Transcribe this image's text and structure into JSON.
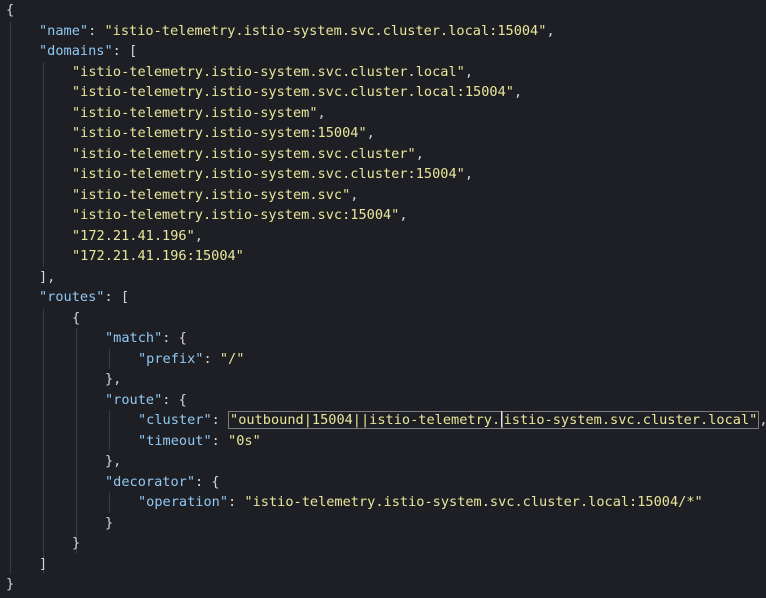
{
  "editor": {
    "lines": [
      {
        "indent": 0,
        "tokens": [
          [
            "pun",
            "{"
          ]
        ]
      },
      {
        "indent": 1,
        "tokens": [
          [
            "key",
            "\"name\""
          ],
          [
            "pun",
            ": "
          ],
          [
            "str",
            "\"istio-telemetry.istio-system.svc.cluster.local:15004\""
          ],
          [
            "pun",
            ","
          ]
        ]
      },
      {
        "indent": 1,
        "tokens": [
          [
            "key",
            "\"domains\""
          ],
          [
            "pun",
            ": ["
          ]
        ]
      },
      {
        "indent": 2,
        "tokens": [
          [
            "str",
            "\"istio-telemetry.istio-system.svc.cluster.local\""
          ],
          [
            "pun",
            ","
          ]
        ]
      },
      {
        "indent": 2,
        "tokens": [
          [
            "str",
            "\"istio-telemetry.istio-system.svc.cluster.local:15004\""
          ],
          [
            "pun",
            ","
          ]
        ]
      },
      {
        "indent": 2,
        "tokens": [
          [
            "str",
            "\"istio-telemetry.istio-system\""
          ],
          [
            "pun",
            ","
          ]
        ]
      },
      {
        "indent": 2,
        "tokens": [
          [
            "str",
            "\"istio-telemetry.istio-system:15004\""
          ],
          [
            "pun",
            ","
          ]
        ]
      },
      {
        "indent": 2,
        "tokens": [
          [
            "str",
            "\"istio-telemetry.istio-system.svc.cluster\""
          ],
          [
            "pun",
            ","
          ]
        ]
      },
      {
        "indent": 2,
        "tokens": [
          [
            "str",
            "\"istio-telemetry.istio-system.svc.cluster:15004\""
          ],
          [
            "pun",
            ","
          ]
        ]
      },
      {
        "indent": 2,
        "tokens": [
          [
            "str",
            "\"istio-telemetry.istio-system.svc\""
          ],
          [
            "pun",
            ","
          ]
        ]
      },
      {
        "indent": 2,
        "tokens": [
          [
            "str",
            "\"istio-telemetry.istio-system.svc:15004\""
          ],
          [
            "pun",
            ","
          ]
        ]
      },
      {
        "indent": 2,
        "tokens": [
          [
            "str",
            "\"172.21.41.196\""
          ],
          [
            "pun",
            ","
          ]
        ]
      },
      {
        "indent": 2,
        "tokens": [
          [
            "str",
            "\"172.21.41.196:15004\""
          ]
        ]
      },
      {
        "indent": 1,
        "tokens": [
          [
            "pun",
            "],"
          ]
        ]
      },
      {
        "indent": 1,
        "tokens": [
          [
            "key",
            "\"routes\""
          ],
          [
            "pun",
            ": ["
          ]
        ]
      },
      {
        "indent": 2,
        "tokens": [
          [
            "pun",
            "{"
          ]
        ]
      },
      {
        "indent": 3,
        "tokens": [
          [
            "key",
            "\"match\""
          ],
          [
            "pun",
            ": {"
          ]
        ]
      },
      {
        "indent": 4,
        "tokens": [
          [
            "key",
            "\"prefix\""
          ],
          [
            "pun",
            ": "
          ],
          [
            "str",
            "\"/\""
          ]
        ]
      },
      {
        "indent": 3,
        "tokens": [
          [
            "pun",
            "},"
          ]
        ]
      },
      {
        "indent": 3,
        "tokens": [
          [
            "key",
            "\"route\""
          ],
          [
            "pun",
            ": {"
          ]
        ]
      },
      {
        "indent": 4,
        "tokens": [
          [
            "key",
            "\"cluster\""
          ],
          [
            "pun",
            ": "
          ],
          [
            "str-hl",
            "\"outbound|15004||istio-telemetry."
          ],
          [
            "cursor",
            ""
          ],
          [
            "str-hl",
            "istio-system.svc.cluster.local\""
          ],
          [
            "pun",
            ","
          ]
        ]
      },
      {
        "indent": 4,
        "tokens": [
          [
            "key",
            "\"timeout\""
          ],
          [
            "pun",
            ": "
          ],
          [
            "str",
            "\"0s\""
          ]
        ]
      },
      {
        "indent": 3,
        "tokens": [
          [
            "pun",
            "},"
          ]
        ]
      },
      {
        "indent": 3,
        "tokens": [
          [
            "key",
            "\"decorator\""
          ],
          [
            "pun",
            ": {"
          ]
        ]
      },
      {
        "indent": 4,
        "tokens": [
          [
            "key",
            "\"operation\""
          ],
          [
            "pun",
            ": "
          ],
          [
            "str",
            "\"istio-telemetry.istio-system.svc.cluster.local:15004/*\""
          ]
        ]
      },
      {
        "indent": 3,
        "tokens": [
          [
            "pun",
            "}"
          ]
        ]
      },
      {
        "indent": 2,
        "tokens": [
          [
            "pun",
            "}"
          ]
        ]
      },
      {
        "indent": 1,
        "tokens": [
          [
            "pun",
            "]"
          ]
        ]
      },
      {
        "indent": 0,
        "tokens": [
          [
            "pun",
            "}"
          ]
        ]
      }
    ]
  }
}
